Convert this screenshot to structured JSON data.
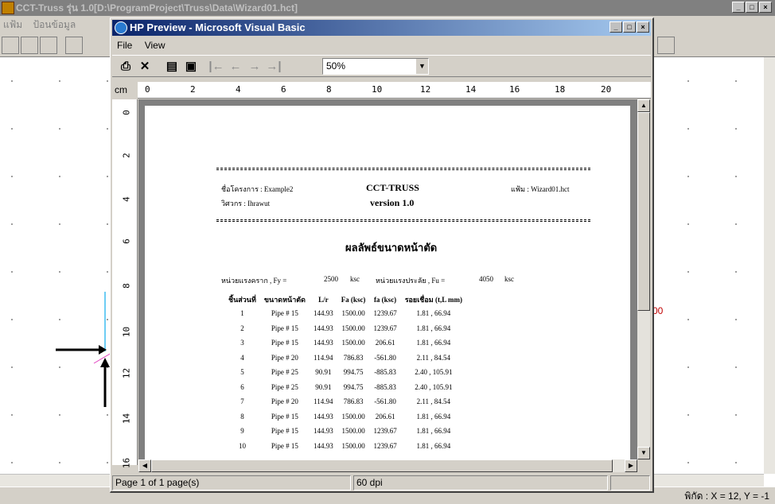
{
  "background_app": {
    "title": "CCT-Truss รุ่น 1.0[D:\\ProgramProject\\Truss\\Data\\Wizard01.hct]",
    "menu": [
      "แฟ้ม",
      "ป้อนข้อมูล"
    ],
    "status_coords": "พิกัด : X = 12, Y = -1",
    "canvas_label": "00"
  },
  "preview_window": {
    "title": "HP Preview - Microsoft Visual Basic",
    "menu": {
      "file": "File",
      "view": "View"
    },
    "toolbar": {
      "print_icon": "printer-icon",
      "close_icon": "close-icon",
      "properties_icon": "properties-icon",
      "save_icon": "save-icon",
      "first_icon": "first-page-icon",
      "prev_icon": "prev-page-icon",
      "next_icon": "next-page-icon",
      "last_icon": "last-page-icon",
      "zoom_value": "50%"
    },
    "ruler": {
      "unit": "cm",
      "top_ticks": [
        "0",
        "2",
        "4",
        "6",
        "8",
        "10",
        "12",
        "14",
        "16",
        "18",
        "20"
      ],
      "left_ticks": [
        "0",
        "2",
        "4",
        "6",
        "8",
        "10",
        "12",
        "14",
        "16"
      ]
    },
    "status": {
      "page": "Page 1 of 1 page(s)",
      "dpi": "60 dpi"
    }
  },
  "report": {
    "project_label": "ชื่อโครงการ : Example2",
    "engineer_label": "วิศวกร : Ihrawut",
    "app_name": "CCT-TRUSS",
    "version": "version 1.0",
    "file_label": "แฟ้ม : Wizard01.hct",
    "section_title": "ผลลัพธ์ขนาดหน้าตัด",
    "fy_label": "หน่วยแรงคราก , Fy =",
    "fy_value": "2500",
    "fy_unit": "ksc",
    "fu_label": "หน่วยแรงประลัย , Fu =",
    "fu_value": "4050",
    "fu_unit": "ksc",
    "columns": [
      "ชิ้นส่วนที่",
      "ขนาดหน้าตัด",
      "L/r",
      "Fa (ksc)",
      "fa (ksc)",
      "รอยเชื่อม (t,L mm)"
    ],
    "rows": [
      [
        "1",
        "Pipe # 15",
        "144.93",
        "1500.00",
        "1239.67",
        "1.81 , 66.94"
      ],
      [
        "2",
        "Pipe # 15",
        "144.93",
        "1500.00",
        "1239.67",
        "1.81 , 66.94"
      ],
      [
        "3",
        "Pipe # 15",
        "144.93",
        "1500.00",
        "206.61",
        "1.81 , 66.94"
      ],
      [
        "4",
        "Pipe # 20",
        "114.94",
        "786.83",
        "-561.80",
        "2.11 , 84.54"
      ],
      [
        "5",
        "Pipe # 25",
        "90.91",
        "994.75",
        "-885.83",
        "2.40 , 105.91"
      ],
      [
        "6",
        "Pipe # 25",
        "90.91",
        "994.75",
        "-885.83",
        "2.40 , 105.91"
      ],
      [
        "7",
        "Pipe # 20",
        "114.94",
        "786.83",
        "-561.80",
        "2.11 , 84.54"
      ],
      [
        "8",
        "Pipe # 15",
        "144.93",
        "1500.00",
        "206.61",
        "1.81 , 66.94"
      ],
      [
        "9",
        "Pipe # 15",
        "144.93",
        "1500.00",
        "1239.67",
        "1.81 , 66.94"
      ],
      [
        "10",
        "Pipe # 15",
        "144.93",
        "1500.00",
        "1239.67",
        "1.81 , 66.94"
      ]
    ]
  }
}
